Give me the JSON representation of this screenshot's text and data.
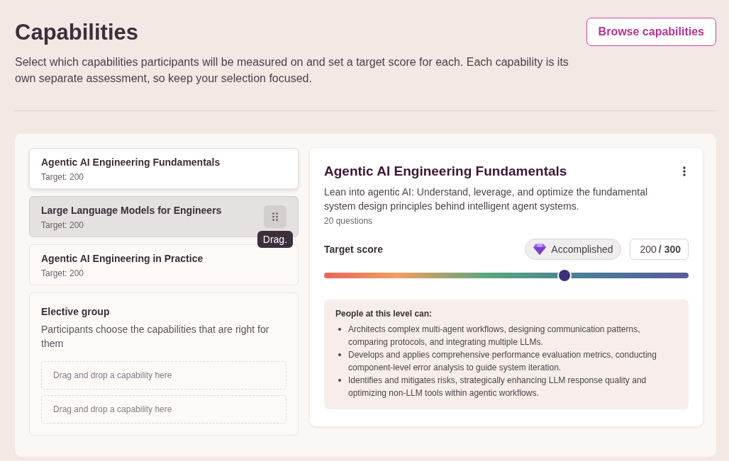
{
  "header": {
    "title": "Capabilities",
    "description": "Select which capabilities participants will be measured on and set a target score for each. Each capability is its own separate assessment, so keep your selection focused.",
    "browse_button": "Browse capabilities"
  },
  "capabilities": [
    {
      "name": "Agentic AI Engineering Fundamentals",
      "target": "Target: 200",
      "selected": true,
      "hovered": false
    },
    {
      "name": "Large Language Models for Engineers",
      "target": "Target: 200",
      "selected": false,
      "hovered": true,
      "tooltip": "Drag."
    },
    {
      "name": "Agentic AI Engineering in Practice",
      "target": "Target: 200",
      "selected": false,
      "hovered": false
    }
  ],
  "elective_group": {
    "title": "Elective group",
    "description": "Participants choose the capabilities that are right for them",
    "drop_zones": [
      "Drag and drop a capability here",
      "Drag and drop a capability here"
    ]
  },
  "detail": {
    "title": "Agentic AI Engineering Fundamentals",
    "description": "Lean into agentic AI: Understand, leverage, and optimize the fundamental system design principles behind intelligent agent systems.",
    "questions": "20 questions",
    "target_label": "Target score",
    "level_badge": "Accomplished",
    "score": "200",
    "max_score": "/ 300",
    "level": 0.66,
    "level_box": {
      "heading": "People at this level can:",
      "items": [
        "Architects complex multi-agent workflows, designing communication patterns, comparing protocols, and integrating multiple LLMs.",
        "Develops and applies comprehensive performance evaluation metrics, conducting component-level error analysis to guide system iteration.",
        "Identifies and mitigates risks, strategically enhancing LLM response quality and optimizing non-LLM tools within agentic workflows."
      ]
    }
  }
}
